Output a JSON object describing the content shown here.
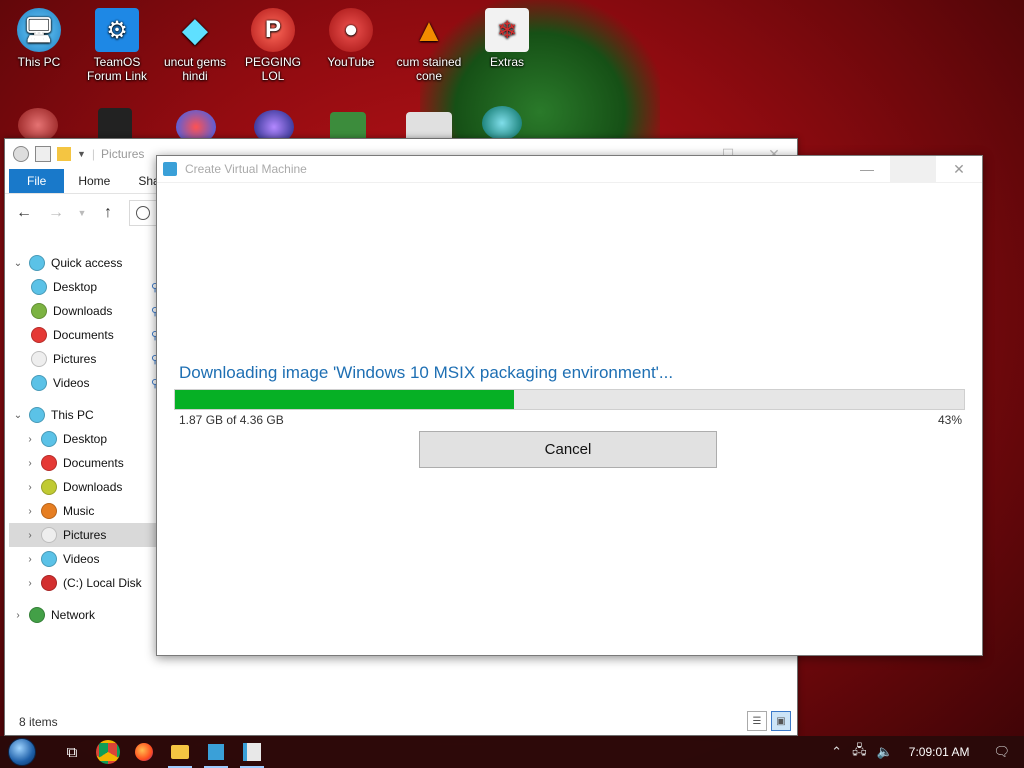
{
  "desktop": {
    "icons": [
      {
        "label": "This PC",
        "icon": "this-pc-icon",
        "color": "#2a9fd8"
      },
      {
        "label": "TeamOS Forum Link",
        "icon": "gear-icon",
        "color": "#1e88e5"
      },
      {
        "label": "uncut gems hindi",
        "icon": "diamond-icon",
        "color": "#36c5f0"
      },
      {
        "label": "PEGGING LOL",
        "icon": "p-logo-icon",
        "color": "#d03030"
      },
      {
        "label": "YouTube",
        "icon": "angry-bird-icon",
        "color": "#c62828"
      },
      {
        "label": "cum stained cone",
        "icon": "vlc-cone-icon",
        "color": "#f08a00"
      },
      {
        "label": "Extras",
        "icon": "gift-folder-icon",
        "color": "#e23b3b"
      }
    ]
  },
  "explorer": {
    "title": "Pictures",
    "tabs": [
      "File",
      "Home",
      "Sha"
    ],
    "nav": {
      "quick_access": {
        "label": "Quick access",
        "items": [
          {
            "label": "Desktop",
            "color": "#5bc2e7"
          },
          {
            "label": "Downloads",
            "color": "#7cb342"
          },
          {
            "label": "Documents",
            "color": "#e53935"
          },
          {
            "label": "Pictures",
            "color": "#eeeeee"
          },
          {
            "label": "Videos",
            "color": "#5bc2e7"
          }
        ]
      },
      "this_pc": {
        "label": "This PC",
        "items": [
          {
            "label": "Desktop",
            "color": "#5bc2e7"
          },
          {
            "label": "Documents",
            "color": "#e53935"
          },
          {
            "label": "Downloads",
            "color": "#c0ca33"
          },
          {
            "label": "Music",
            "color": "#e67e22"
          },
          {
            "label": "Pictures",
            "color": "#eeeeee"
          },
          {
            "label": "Videos",
            "color": "#5bc2e7"
          },
          {
            "label": "(C:) Local Disk",
            "color": "#d32f2f"
          }
        ]
      },
      "network": {
        "label": "Network",
        "color": "#43a047"
      }
    },
    "status_text": "8 items"
  },
  "dialog": {
    "title": "Create Virtual Machine",
    "heading": "Downloading image 'Windows 10 MSIX packaging environment'...",
    "progress_percent": 43,
    "progress_label": "43%",
    "downloaded_text": "1.87 GB of 4.36 GB",
    "cancel_label": "Cancel",
    "progress_color": "#06b025"
  },
  "taskbar": {
    "apps": [
      "task-view-icon",
      "chrome-icon",
      "firefox-icon",
      "file-explorer-icon",
      "hyperv-icon",
      "create-vm-icon"
    ],
    "time": "7:09:01 AM"
  }
}
